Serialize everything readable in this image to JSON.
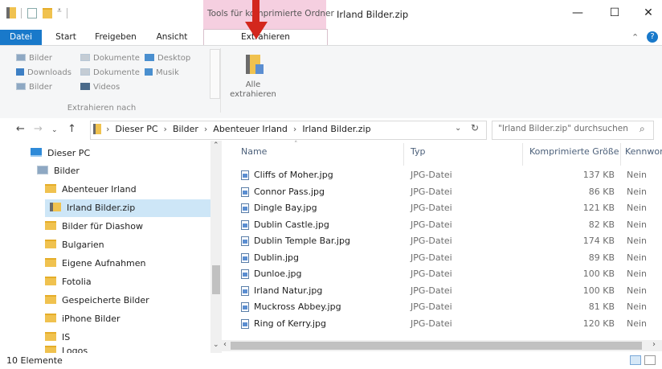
{
  "title_bar": {
    "context_tab": "Tools für komprimierte Ordner",
    "window_title": "Irland Bilder.zip",
    "minimize": "—",
    "maximize": "☐",
    "close": "✕"
  },
  "tabs": {
    "datei": "Datei",
    "start": "Start",
    "freigeben": "Freigeben",
    "ansicht": "Ansicht",
    "extrahieren": "Extrahieren"
  },
  "ribbon": {
    "destinations": [
      "Bilder",
      "Dokumente",
      "Desktop",
      "Downloads",
      "Dokumente",
      "Musik",
      "Bilder",
      "Videos"
    ],
    "group_label": "Extrahieren nach",
    "extract_all_label": "Alle extrahieren"
  },
  "address": {
    "crumbs": [
      "Dieser PC",
      "Bilder",
      "Abenteuer Irland",
      "Irland Bilder.zip"
    ],
    "search_placeholder": "\"Irland Bilder.zip\" durchsuchen"
  },
  "nav_pane": {
    "items": [
      "Dieser PC",
      "Bilder",
      "Abenteuer Irland",
      "Irland Bilder.zip",
      "Bilder für Diashow",
      "Bulgarien",
      "Eigene Aufnahmen",
      "Fotolia",
      "Gespeicherte Bilder",
      "iPhone Bilder",
      "IS",
      "Logos"
    ]
  },
  "columns": {
    "name": "Name",
    "type": "Typ",
    "compressed_size": "Komprimierte Größe",
    "password": "Kennwort"
  },
  "files": [
    {
      "name": "Cliffs of Moher.jpg",
      "type": "JPG-Datei",
      "size": "137 KB",
      "pw": "Nein"
    },
    {
      "name": "Connor Pass.jpg",
      "type": "JPG-Datei",
      "size": "86 KB",
      "pw": "Nein"
    },
    {
      "name": "Dingle Bay.jpg",
      "type": "JPG-Datei",
      "size": "121 KB",
      "pw": "Nein"
    },
    {
      "name": "Dublin Castle.jpg",
      "type": "JPG-Datei",
      "size": "82 KB",
      "pw": "Nein"
    },
    {
      "name": "Dublin Temple Bar.jpg",
      "type": "JPG-Datei",
      "size": "174 KB",
      "pw": "Nein"
    },
    {
      "name": "Dublin.jpg",
      "type": "JPG-Datei",
      "size": "89 KB",
      "pw": "Nein"
    },
    {
      "name": "Dunloe.jpg",
      "type": "JPG-Datei",
      "size": "100 KB",
      "pw": "Nein"
    },
    {
      "name": "Irland Natur.jpg",
      "type": "JPG-Datei",
      "size": "100 KB",
      "pw": "Nein"
    },
    {
      "name": "Muckross Abbey.jpg",
      "type": "JPG-Datei",
      "size": "81 KB",
      "pw": "Nein"
    },
    {
      "name": "Ring of Kerry.jpg",
      "type": "JPG-Datei",
      "size": "120 KB",
      "pw": "Nein"
    }
  ],
  "status": {
    "count": "10 Elemente"
  },
  "colors": {
    "accent": "#1979ca",
    "context_tab": "#f5cfe0",
    "selection": "#cde6f7",
    "arrow": "#d3271d"
  }
}
